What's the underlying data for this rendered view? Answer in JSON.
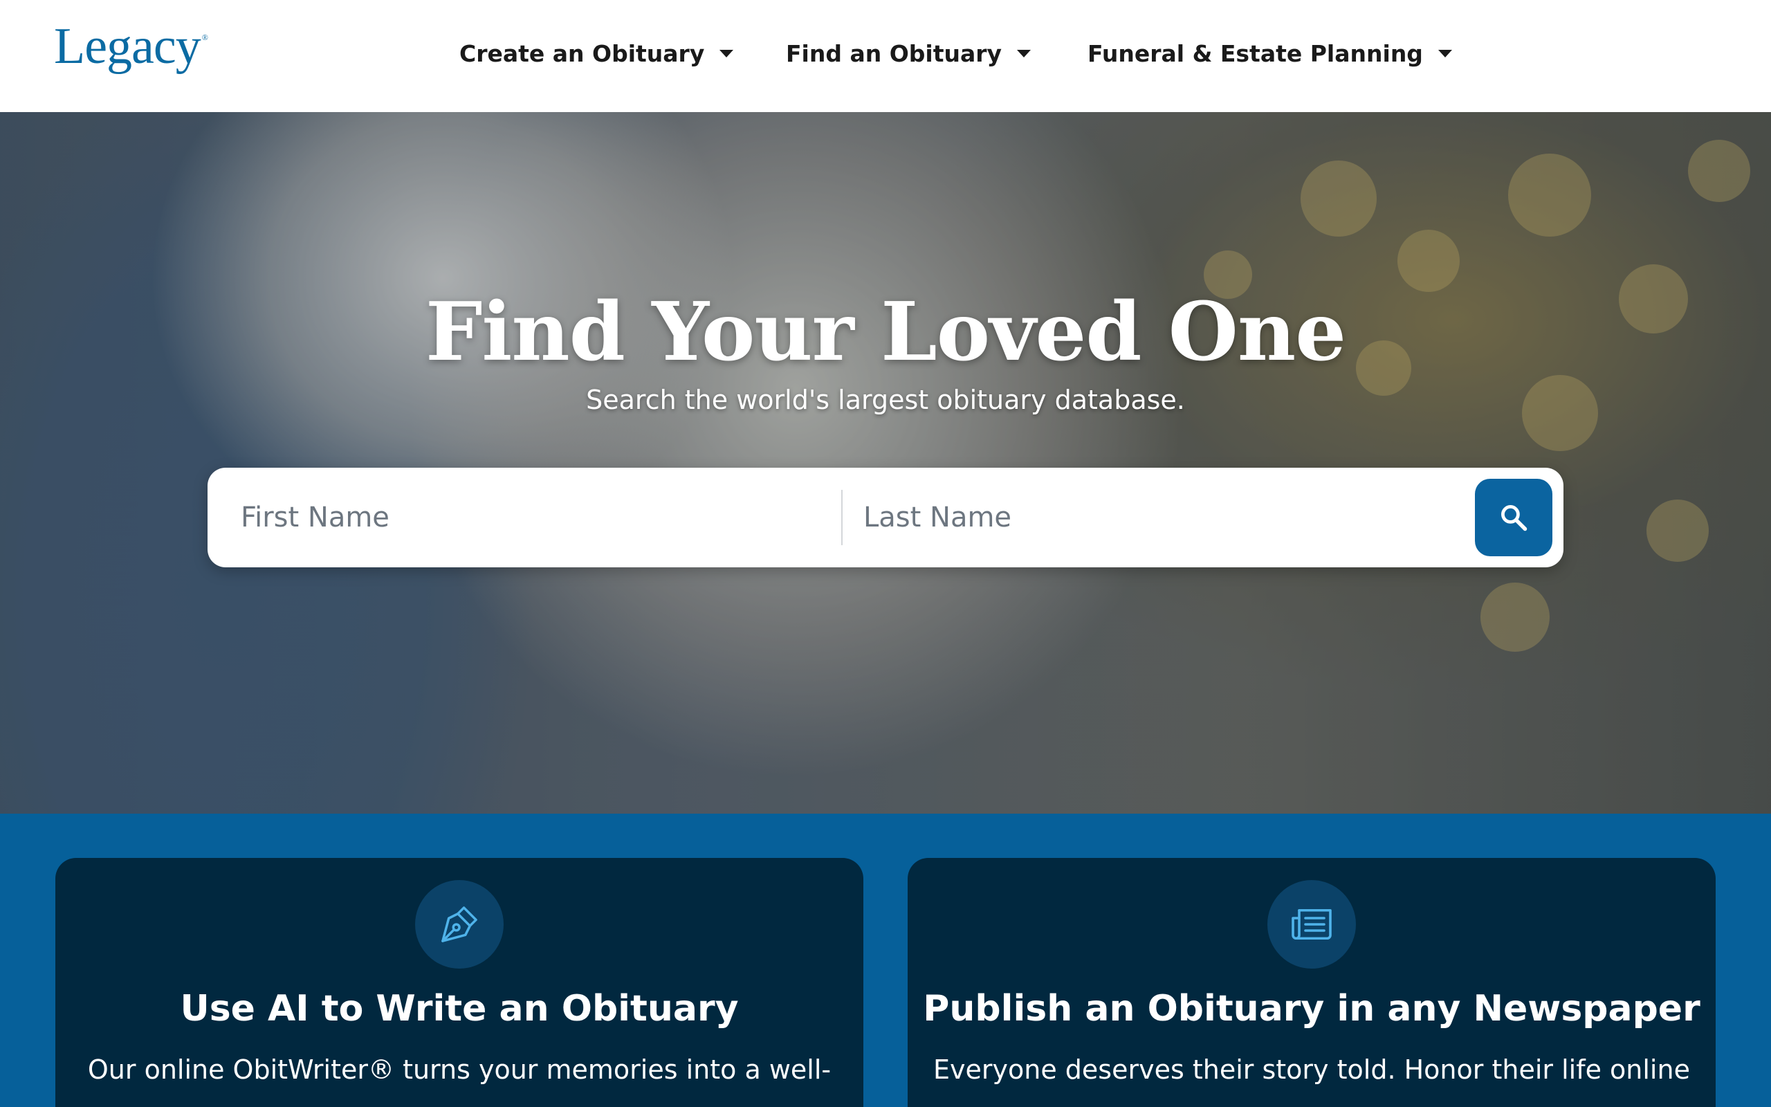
{
  "header": {
    "logo_text": "Legacy",
    "logo_mark": "®",
    "nav": [
      {
        "label": "Create an Obituary"
      },
      {
        "label": "Find an Obituary"
      },
      {
        "label": "Funeral & Estate Planning"
      }
    ]
  },
  "hero": {
    "title": "Find Your Loved One",
    "subtitle": "Search the world's largest obituary database.",
    "search": {
      "first_name_placeholder": "First Name",
      "last_name_placeholder": "Last Name",
      "button_icon": "search-icon"
    }
  },
  "cards": [
    {
      "icon": "pen-nib-icon",
      "title": "Use AI to Write an Obituary",
      "body": "Our online ObitWriter® turns your memories into a well-"
    },
    {
      "icon": "newspaper-icon",
      "title": "Publish an Obituary in any Newspaper",
      "body": "Everyone deserves their story told. Honor their life online"
    }
  ],
  "colors": {
    "brand_blue": "#0b64a0",
    "band_blue": "#06609a",
    "card_navy": "#01283f",
    "icon_accent": "#4fb3ea"
  }
}
